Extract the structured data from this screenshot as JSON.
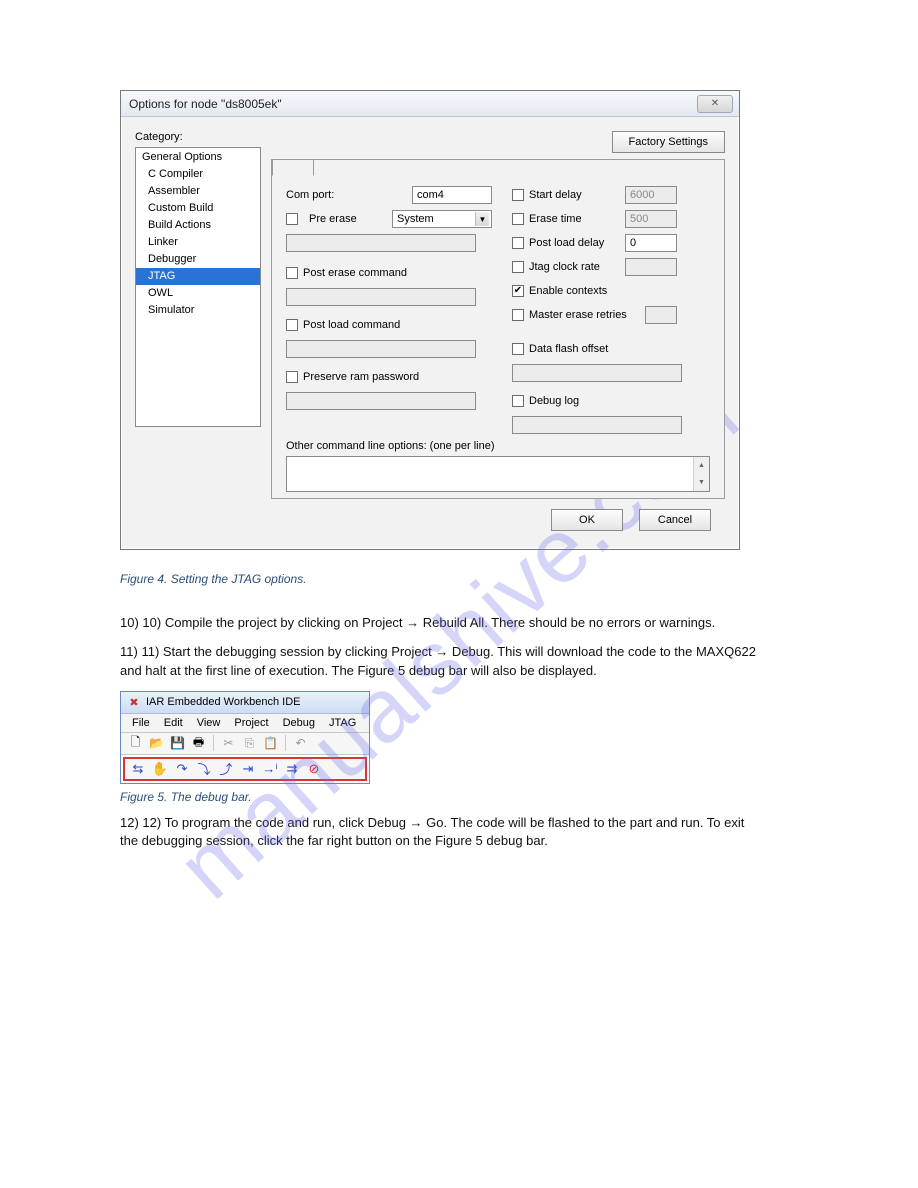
{
  "dialog": {
    "title": "Options for node \"ds8005ek\"",
    "category_label": "Category:",
    "factory_settings": "Factory Settings",
    "categories": [
      {
        "label": "General Options",
        "indent": false
      },
      {
        "label": "C Compiler",
        "indent": true
      },
      {
        "label": "Assembler",
        "indent": true
      },
      {
        "label": "Custom Build",
        "indent": true
      },
      {
        "label": "Build Actions",
        "indent": true
      },
      {
        "label": "Linker",
        "indent": true
      },
      {
        "label": "Debugger",
        "indent": true
      },
      {
        "label": "JTAG",
        "indent": true,
        "selected": true
      },
      {
        "label": "OWL",
        "indent": true
      },
      {
        "label": "Simulator",
        "indent": true
      }
    ],
    "fields": {
      "com_port_label": "Com port:",
      "com_port_value": "com4",
      "pre_erase_label": "Pre erase",
      "pre_erase_select": "System",
      "post_erase_label": "Post erase command",
      "post_load_label": "Post load command",
      "preserve_ram_label": "Preserve ram password",
      "other_label": "Other command line options:  (one per line)",
      "start_delay_label": "Start delay",
      "start_delay_value": "6000",
      "erase_time_label": "Erase time",
      "erase_time_value": "500",
      "post_load_delay_label": "Post load delay",
      "post_load_delay_value": "0",
      "jtag_clock_label": "Jtag clock rate",
      "enable_contexts_label": "Enable contexts",
      "master_erase_label": "Master erase retries",
      "data_flash_label": "Data flash offset",
      "debug_log_label": "Debug log"
    },
    "ok": "OK",
    "cancel": "Cancel"
  },
  "body_text": {
    "step10": "10) Compile the project by clicking on Project → Rebuild All. There should be no errors or warnings.",
    "step11": "11) Start the debugging session by clicking Project → Debug. This will download the code to the MAXQ622 and halt at the first line of execution. The Figure 5 debug bar will also be displayed.",
    "fig5_caption": "Figure 5. The debug bar.",
    "step12": "12) To program the code and run, click Debug → Go. The code will be flashed to the part and run. To exit the debugging session, click the far right button on the Figure 5 debug bar.",
    "fig4_caption": "Figure 4. Setting the JTAG options."
  },
  "ide": {
    "title": "IAR Embedded Workbench IDE",
    "menus": [
      "File",
      "Edit",
      "View",
      "Project",
      "Debug",
      "JTAG"
    ],
    "toolbar_icons": [
      "new",
      "open",
      "save",
      "print",
      "cut",
      "copy",
      "paste",
      "undo"
    ],
    "debug_icons": [
      "reset",
      "break",
      "step-over",
      "step-into",
      "step-out",
      "run-to",
      "next-stmt",
      "run",
      "run-fast",
      "stop"
    ]
  },
  "watermark": "manualshive.com"
}
